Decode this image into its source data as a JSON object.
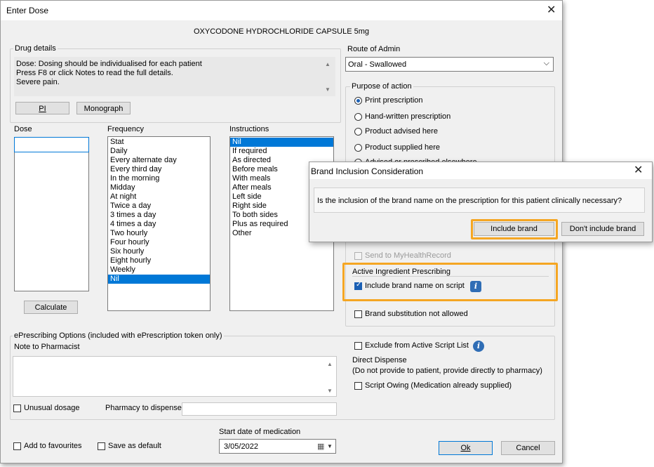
{
  "window": {
    "title": "Enter Dose",
    "close_glyph": "✕"
  },
  "drug_name": "OXYCODONE HYDROCHLORIDE CAPSULE 5mg",
  "drug_details": {
    "label": "Drug details",
    "lines": [
      "Dose: Dosing should be individualised for each patient",
      "Press F8 or click  Notes to read the full details.",
      "Severe  pain."
    ],
    "pi_button": "PI",
    "monograph_button": "Monograph"
  },
  "route": {
    "label": "Route of Admin",
    "value": "Oral - Swallowed"
  },
  "purpose": {
    "label": "Purpose of action",
    "options": [
      "Print prescription",
      "Hand-written prescription",
      "Product advised here",
      "Product supplied here",
      "Advised or prescribed elsewhere"
    ],
    "selected_index": 0
  },
  "dose": {
    "label": "Dose",
    "value": "",
    "calculate_button": "Calculate"
  },
  "frequency": {
    "label": "Frequency",
    "items": [
      "Stat",
      "Daily",
      "Every alternate day",
      "Every third day",
      "In the morning",
      "Midday",
      "At night",
      "Twice a day",
      "3 times a day",
      "4 times a day",
      "Two hourly",
      "Four hourly",
      "Six hourly",
      "Eight hourly",
      "Weekly",
      "Nil"
    ],
    "selected": "Nil"
  },
  "instructions": {
    "label": "Instructions",
    "items": [
      "Nil",
      "If required",
      "As directed",
      "Before meals",
      "With meals",
      "After meals",
      "Left side",
      "Right side",
      "To both sides",
      "Plus as required",
      "Other"
    ],
    "selected": "Nil"
  },
  "send_mhr": "Send to MyHealthRecord",
  "active_ingredient": {
    "label": "Active Ingredient Prescribing",
    "include_brand": "Include brand name on script",
    "include_brand_checked": true
  },
  "brand_substitution": "Brand substitution not allowed",
  "eprescribing": {
    "label": "ePrescribing Options (included with ePrescription token only)",
    "note_label": "Note to Pharmacist",
    "note_value": "",
    "unusual_dosage": "Unusual dosage",
    "pharmacy_label": "Pharmacy to dispense",
    "pharmacy_value": "",
    "exclude_active": "Exclude from Active Script List",
    "direct_dispense_label": "Direct Dispense",
    "direct_dispense_note": "(Do not provide to patient, provide directly to pharmacy)",
    "script_owing": "Script Owing (Medication already supplied)"
  },
  "footer": {
    "add_favourites": "Add to favourites",
    "save_default": "Save as default",
    "start_date_label": "Start date of medication",
    "start_date": "3/05/2022",
    "ok_button": "Ok",
    "cancel_button": "Cancel"
  },
  "popup": {
    "title": "Brand Inclusion Consideration",
    "message": "Is the inclusion of the brand name on the prescription for this patient clinically necessary?",
    "include_button": "Include brand",
    "dont_include_button": "Don't include brand",
    "close_glyph": "✕"
  },
  "colors": {
    "highlight": "#f5a623",
    "selection": "#0078d7",
    "info_icon": "#2f6db5"
  }
}
